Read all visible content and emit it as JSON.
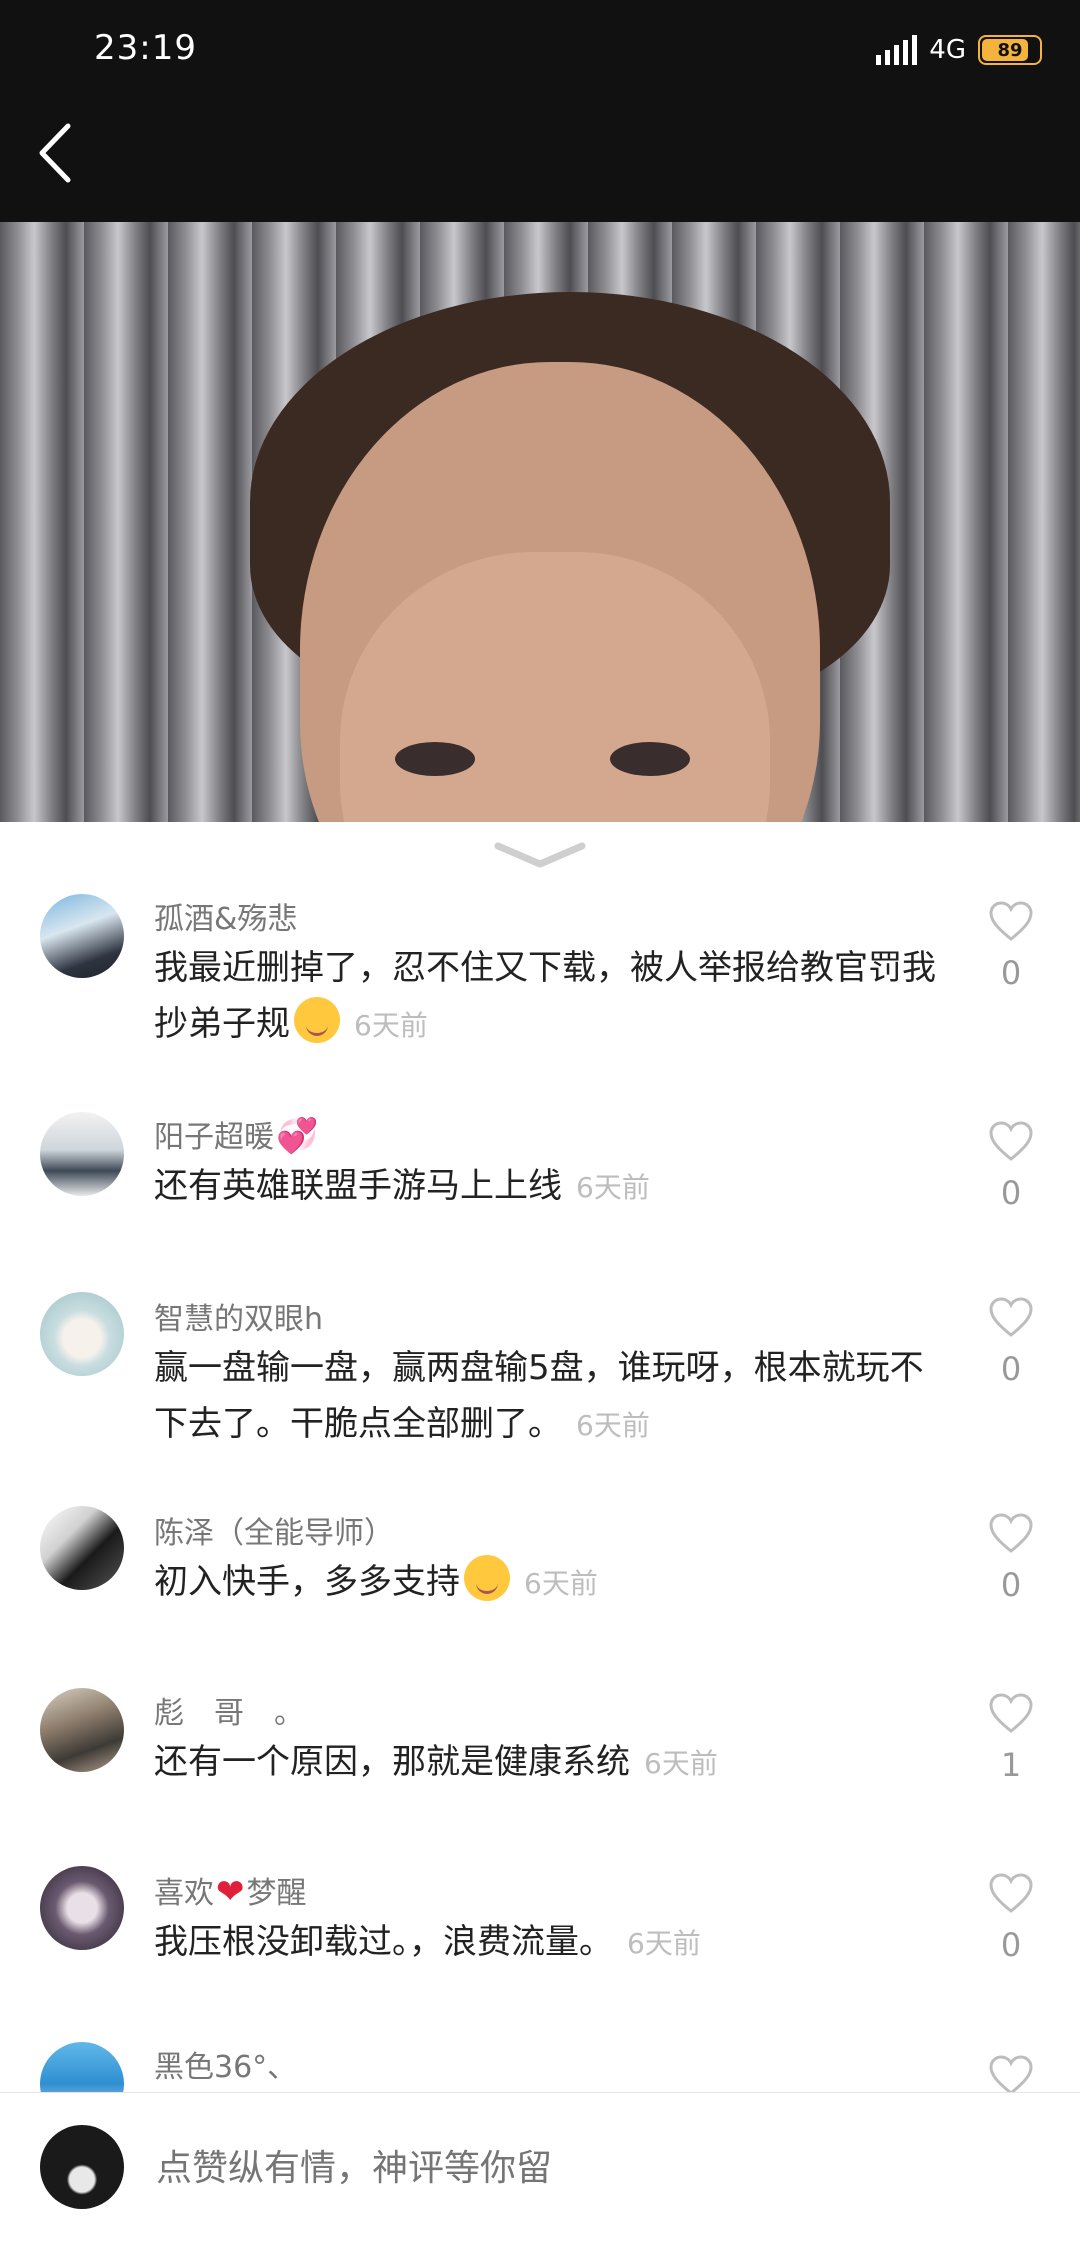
{
  "status_bar": {
    "time": "23:19",
    "network": "4G",
    "battery": "89",
    "battery_level": 0.89
  },
  "comments": [
    {
      "name": "孤酒&殇悲",
      "text": "我最近删掉了，忍不住又下载，被人举报给教官罚我抄弟子规",
      "emoji": "laughing-emoji",
      "time": "6天前",
      "likes": "0"
    },
    {
      "name": "阳子超暖",
      "name_icon": "hearts-emoji",
      "text": "还有英雄联盟手游马上上线",
      "time": "6天前",
      "likes": "0"
    },
    {
      "name": "智慧的双眼h",
      "text": "赢一盘输一盘，赢两盘输5盘，谁玩呀，根本就玩不下去了。干脆点全部删了。",
      "time": "6天前",
      "likes": "0"
    },
    {
      "name": "陈泽（全能导师）",
      "text": "初入快手，多多支持",
      "emoji": "smile-emoji",
      "time": "6天前",
      "likes": "0"
    },
    {
      "name": "彪　哥　。",
      "text": "还有一个原因，那就是健康系统",
      "time": "6天前",
      "likes": "1"
    },
    {
      "name_a": "喜欢",
      "name_heart": "❤",
      "name_b": "梦醒",
      "text": "我压根没卸载过。，浪费流量。",
      "time": "6天前",
      "likes": "0"
    },
    {
      "name": "黑色36°、"
    }
  ],
  "input": {
    "placeholder": "点赞纵有情，神评等你留"
  },
  "colors": {
    "header_bg": "#111111",
    "battery": "#f3b33d",
    "heart_inline": "#e0203a"
  }
}
